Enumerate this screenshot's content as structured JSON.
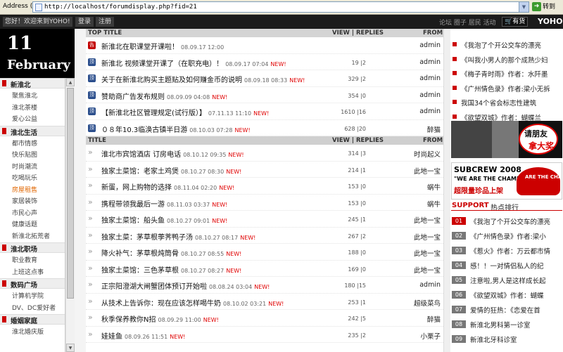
{
  "browser": {
    "address_label": "Address (D)",
    "url": "http://localhost/forumdisplay.php?fid=21",
    "go_label": "转到"
  },
  "topnav": {
    "welcome": "您好！欢迎来到YOHO!",
    "login": "登录",
    "register": "注册",
    "right_links": "论坛 圈子 居民 活动",
    "cart": "有货",
    "logo": "YOHO.."
  },
  "date": {
    "day": "11",
    "month": "February"
  },
  "sidebar": {
    "sections": [
      {
        "title": "新淮北",
        "items": [
          "聚焦淮北",
          "淮北茶楼",
          "爱心公益"
        ]
      },
      {
        "title": "淮北生活",
        "items": [
          "都市情感",
          "快乐贴图",
          "时尚潮流",
          "吃喝玩乐",
          "房屋租售",
          "家居装饰",
          "市民心声",
          "健康话题",
          "新淮北拓荒者"
        ]
      },
      {
        "title": "淮北职场",
        "items": [
          "职业教育",
          "上班这点事"
        ]
      },
      {
        "title": "数码广场",
        "items": [
          "计算机学院",
          "DV、DC爱好者"
        ]
      },
      {
        "title": "婚姻家庭",
        "items": [
          "淮北婚庆版"
        ]
      }
    ],
    "active_item": "房屋租售"
  },
  "table": {
    "top_header": {
      "title": "TOP TITLE",
      "view": "VIEW | REPLIES",
      "from": "FROM"
    },
    "header": {
      "title": "TITLE",
      "view": "VIEW | REPLIES",
      "from": "FROM"
    },
    "new_label": "NEW!",
    "top_rows": [
      {
        "icon": "告",
        "icon_color": "red",
        "title": "新淮北在职课堂开课啦！",
        "date": "08.09.17 12:00",
        "new": false,
        "vr": "",
        "from": "admin"
      },
      {
        "icon": "顶",
        "icon_color": "blue",
        "title": "新淮北 视频课堂开课了（在职充电）！",
        "date": "08.09.17 07:04",
        "new": true,
        "vr": "19 |2",
        "from": "admin"
      },
      {
        "icon": "顶",
        "icon_color": "blue",
        "title": "关于在新淮北购买主题贴及如何赚金币的说明",
        "date": "08.09.18 08:33",
        "new": true,
        "vr": "329 |2",
        "from": "admin"
      },
      {
        "icon": "顶",
        "icon_color": "blue",
        "title": "赞助商广告发布规则",
        "date": "08.09.09 04:08",
        "new": true,
        "vr": "354 |0",
        "from": "admin"
      },
      {
        "icon": "顶",
        "icon_color": "blue",
        "title": "【新淮北社区管理规定(试行版）】",
        "date": "07.11.13 11:10",
        "new": true,
        "vr": "1610 |16",
        "from": "admin"
      },
      {
        "icon": "顶",
        "icon_color": "blue",
        "title": "０８年10.3临涣古镇半日游",
        "date": "08.10.03 07:28",
        "new": true,
        "vr": "628 |20",
        "from": "醉猫"
      }
    ],
    "rows": [
      {
        "title": "淮北市宾馆酒店 订房电话",
        "date": "08.10.12 09:35",
        "vr": "314 |3",
        "from": "时尚起义"
      },
      {
        "title": "独家土菜馆：老家土鸡煲",
        "date": "08.10.27 08:30",
        "vr": "214 |1",
        "from": "此地一宝"
      },
      {
        "title": "新蛋，网上购物的选择",
        "date": "08.11.04 02:20",
        "vr": "153 |0",
        "from": "蜗牛"
      },
      {
        "title": "携程带领我最后一游",
        "date": "08.11.03 03:37",
        "vr": "153 |0",
        "from": "蜗牛"
      },
      {
        "title": "独家土菜馆：船头鱼",
        "date": "08.10.27 09:01",
        "vr": "245 |1",
        "from": "此地一宝"
      },
      {
        "title": "独家土菜：茅草根荸荠鸭子汤",
        "date": "08.10.27 08:17",
        "vr": "267 |2",
        "from": "此地一宝"
      },
      {
        "title": "降火补气：茅草根炖筒骨",
        "date": "08.10.27 08:55",
        "vr": "188 |0",
        "from": "此地一宝"
      },
      {
        "title": "独家土菜馆：三色茅草根",
        "date": "08.10.27 08:27",
        "vr": "169 |0",
        "from": "此地一宝"
      },
      {
        "title": "正宗阳澄湖大闸蟹团体预订开始啦",
        "date": "08.08.24 03:04",
        "vr": "180 |15",
        "from": "admin"
      },
      {
        "title": "从技术上告诉你：现在应该怎样喝牛奶",
        "date": "08.10.02 03:21",
        "vr": "253 |1",
        "from": "超级菜鸟"
      },
      {
        "title": "秋季保养教你N招",
        "date": "08.09.29 11:00",
        "vr": "242 |5",
        "from": "醉猫"
      },
      {
        "title": "娃娃鱼",
        "date": "08.09.26 11:51",
        "vr": "235 |2",
        "from": "小栗子"
      }
    ]
  },
  "right": {
    "list": [
      "《我泡了个开公交车的漂亮",
      "《叫我小男人的那个成熟少妇",
      "《梅子青时雨》作者：水阡墨",
      "《广州情色录》作者:梁小无拆",
      "我国34个省会标志性建筑",
      "《欲望双城》作者：蝴蝶兰"
    ],
    "ad1": {
      "line1": "请朋友",
      "line2": "拿大奖"
    },
    "ad2": {
      "line1": "SUBCREW 2008",
      "line2": "\"WE ARE THE CHAMPIONS\"",
      "line3": "超限量珍品上架",
      "cap": "ARE THE CHAMPIONS"
    },
    "support": {
      "title": "SUPPORT",
      "subtitle": "热点排行"
    },
    "ranking": [
      {
        "num": "01",
        "text": "《我泡了个开公交车的漂亮"
      },
      {
        "num": "02",
        "text": "《广州情色录》作者:梁小"
      },
      {
        "num": "03",
        "text": "《惹火》作者：万云都市情"
      },
      {
        "num": "04",
        "text": "感！！一对情侣私人的纪"
      },
      {
        "num": "05",
        "text": "注意啦,男人是这样成长起"
      },
      {
        "num": "06",
        "text": "《欲望双城》作者：蝴蝶"
      },
      {
        "num": "07",
        "text": "爱情的狂热：《恋爱在首"
      },
      {
        "num": "08",
        "text": "新淮北男科第一诊室"
      },
      {
        "num": "09",
        "text": "新淮北牙科诊室"
      }
    ]
  },
  "colors": {
    "accent": "#cc0000",
    "active": "#e06600",
    "nav_bg": "#1b1b1b",
    "new": "#e00000"
  }
}
